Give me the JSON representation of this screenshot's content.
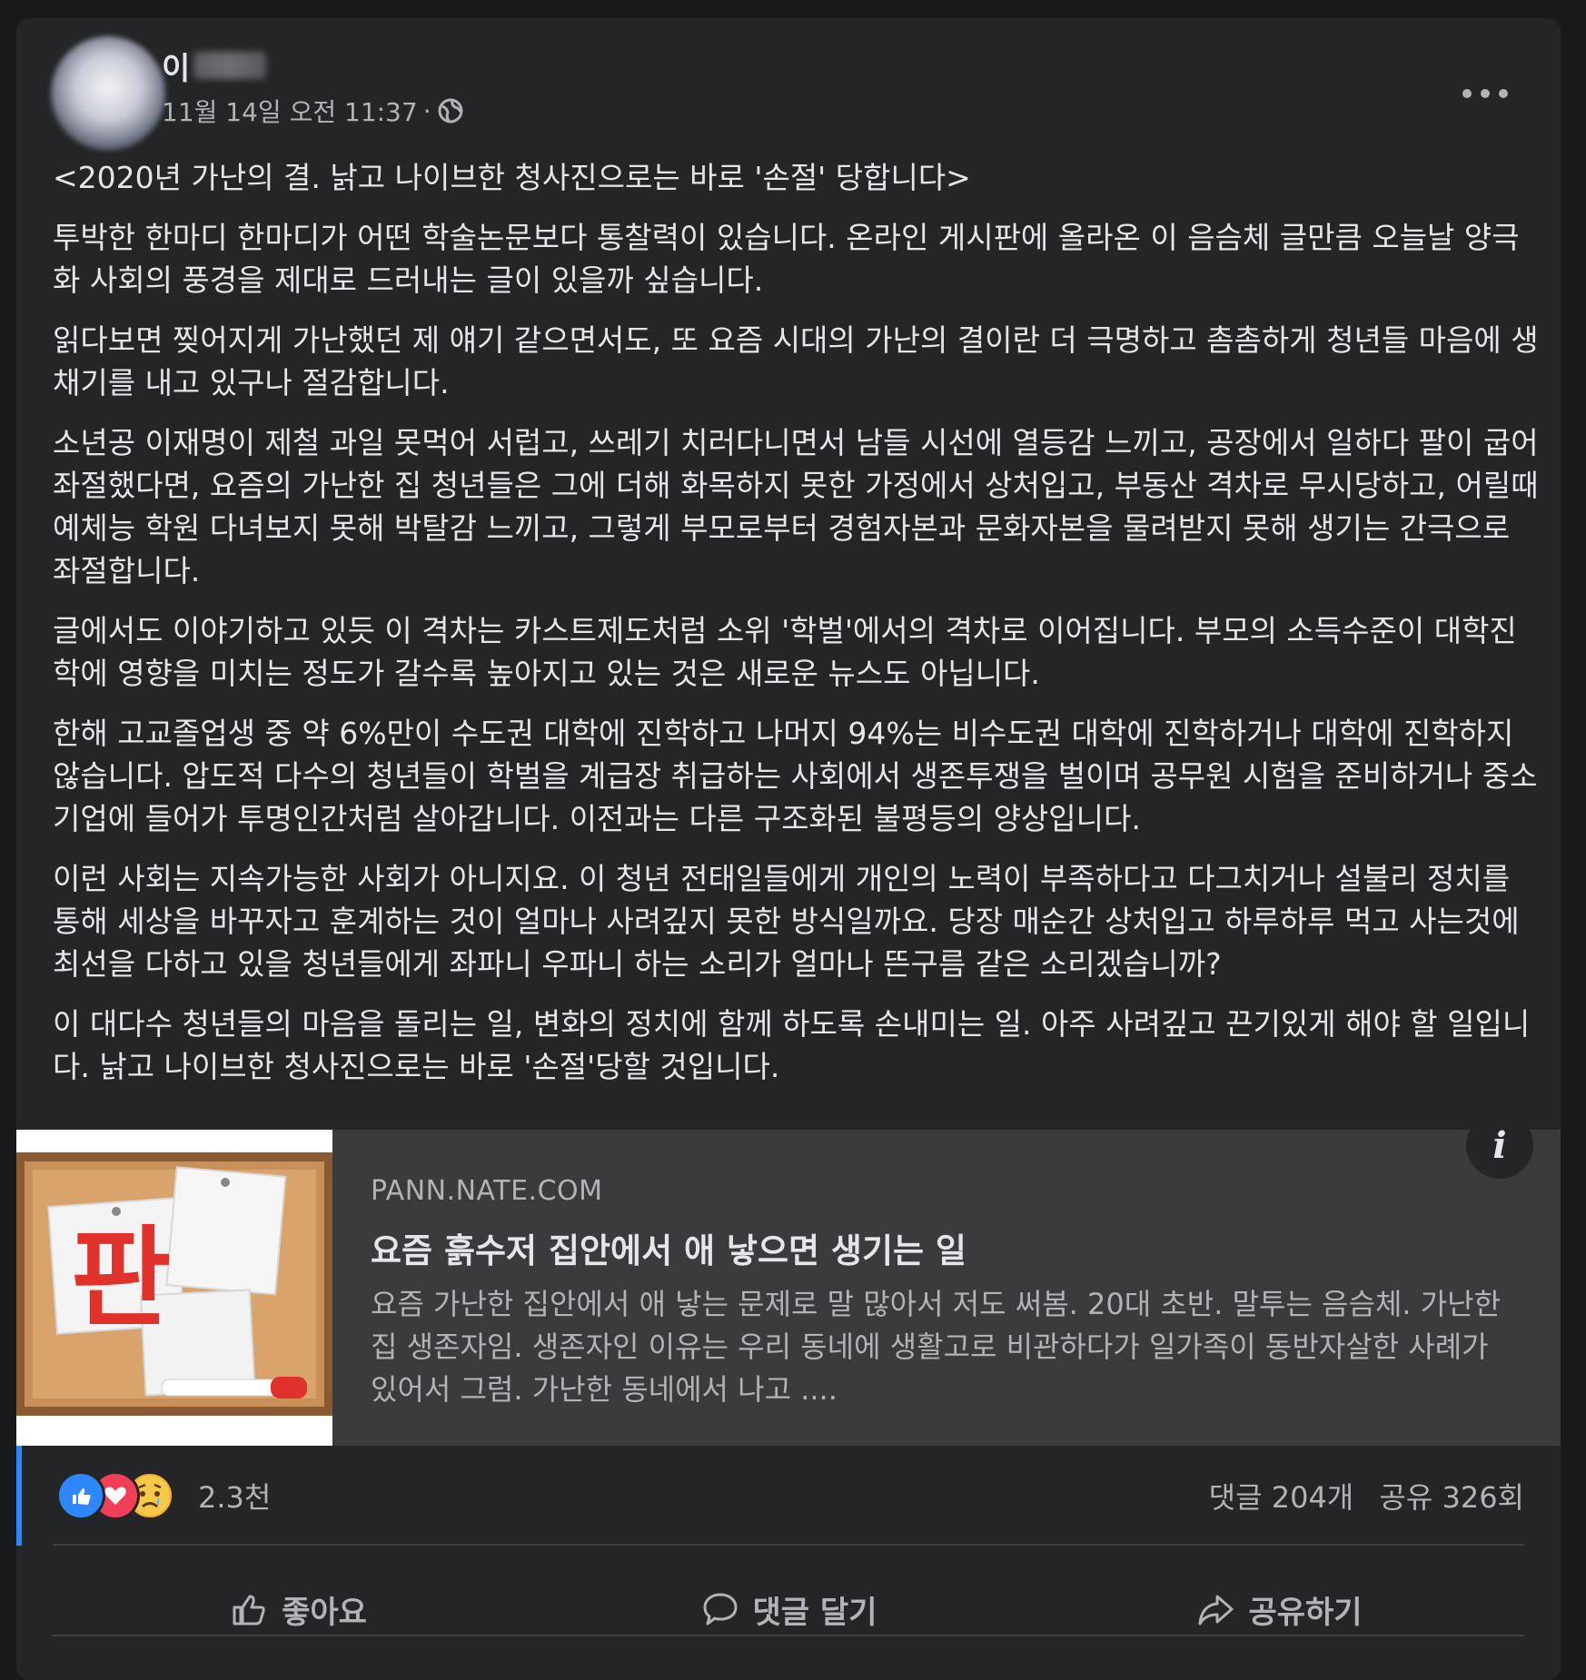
{
  "post": {
    "author_name": "이",
    "date": "11월 14일 오전 11:37",
    "separator": "·",
    "privacy_icon": "globe-icon",
    "menu_icon": "more-icon",
    "paragraphs": [
      "<2020년 가난의 결. 낡고 나이브한 청사진으로는 바로 '손절' 당합니다>",
      "투박한 한마디 한마디가 어떤 학술논문보다 통찰력이 있습니다. 온라인 게시판에 올라온 이 음슴체 글만큼 오늘날 양극화 사회의 풍경을 제대로 드러내는 글이 있을까 싶습니다.",
      "읽다보면 찢어지게 가난했던 제 얘기 같으면서도, 또 요즘 시대의 가난의 결이란 더 극명하고 촘촘하게 청년들 마음에 생채기를 내고 있구나 절감합니다.",
      "소년공 이재명이 제철 과일 못먹어 서럽고, 쓰레기 치러다니면서 남들 시선에 열등감 느끼고, 공장에서 일하다 팔이 굽어 좌절했다면, 요즘의 가난한 집 청년들은 그에 더해 화목하지 못한 가정에서 상처입고, 부동산 격차로 무시당하고, 어릴때 예체능 학원 다녀보지 못해 박탈감 느끼고, 그렇게 부모로부터 경험자본과 문화자본을 물려받지 못해 생기는 간극으로 좌절합니다.",
      "글에서도 이야기하고 있듯 이 격차는 카스트제도처럼 소위 '학벌'에서의 격차로 이어집니다. 부모의 소득수준이 대학진학에 영향을 미치는 정도가 갈수록 높아지고 있는 것은 새로운 뉴스도 아닙니다.",
      "한해 고교졸업생 중 약 6%만이 수도권 대학에 진학하고 나머지 94%는 비수도권 대학에 진학하거나 대학에 진학하지 않습니다. 압도적 다수의 청년들이 학벌을 계급장 취급하는 사회에서 생존투쟁을 벌이며 공무원 시험을 준비하거나 중소기업에 들어가 투명인간처럼 살아갑니다. 이전과는 다른 구조화된 불평등의 양상입니다.",
      "이런 사회는 지속가능한 사회가 아니지요. 이 청년 전태일들에게 개인의 노력이 부족하다고 다그치거나 설불리 정치를 통해 세상을 바꾸자고 훈계하는 것이 얼마나 사려깊지 못한 방식일까요. 당장 매순간 상처입고 하루하루 먹고 사는것에 최선을 다하고 있을 청년들에게 좌파니 우파니 하는 소리가 얼마나 뜬구름 같은 소리겠습니까?",
      "이 대다수 청년들의 마음을 돌리는 일, 변화의 정치에 함께 하도록 손내미는 일. 아주 사려깊고 끈기있게 해야 할 일입니다. 낡고 나이브한 청사진으로는 바로 '손절'당할 것입니다."
    ]
  },
  "link_preview": {
    "domain": "PANN.NATE.COM",
    "title": "요즘 흙수저 집안에서 애 낳으면 생기는 일",
    "description": "요즘 가난한 집안에서 애 낳는 문제로 말 많아서 저도 써봄. 20대 초반. 말투는 음슴체. 가난한 집 생존자임. 생존자인 이유는 우리 동네에 생활고로 비관하다가 일가족이 동반자살한 사례가 있어서 그럼. 가난한 동네에서 나고 ....",
    "thumbnail_text": "판",
    "info_icon": "i"
  },
  "reactions": {
    "icons": [
      "like-icon",
      "love-icon",
      "sad-icon"
    ],
    "count": "2.3천",
    "comments": "댓글 204개",
    "shares": "공유 326회"
  },
  "actions": {
    "like": "좋아요",
    "comment": "댓글 달기",
    "share": "공유하기"
  },
  "colors": {
    "background": "#18191a",
    "card": "#242526",
    "preview": "#3a3b3c",
    "text": "#e4e6eb",
    "muted": "#b0b3b8",
    "accent": "#2d88ff",
    "thumbnail_red": "#e0322a"
  }
}
